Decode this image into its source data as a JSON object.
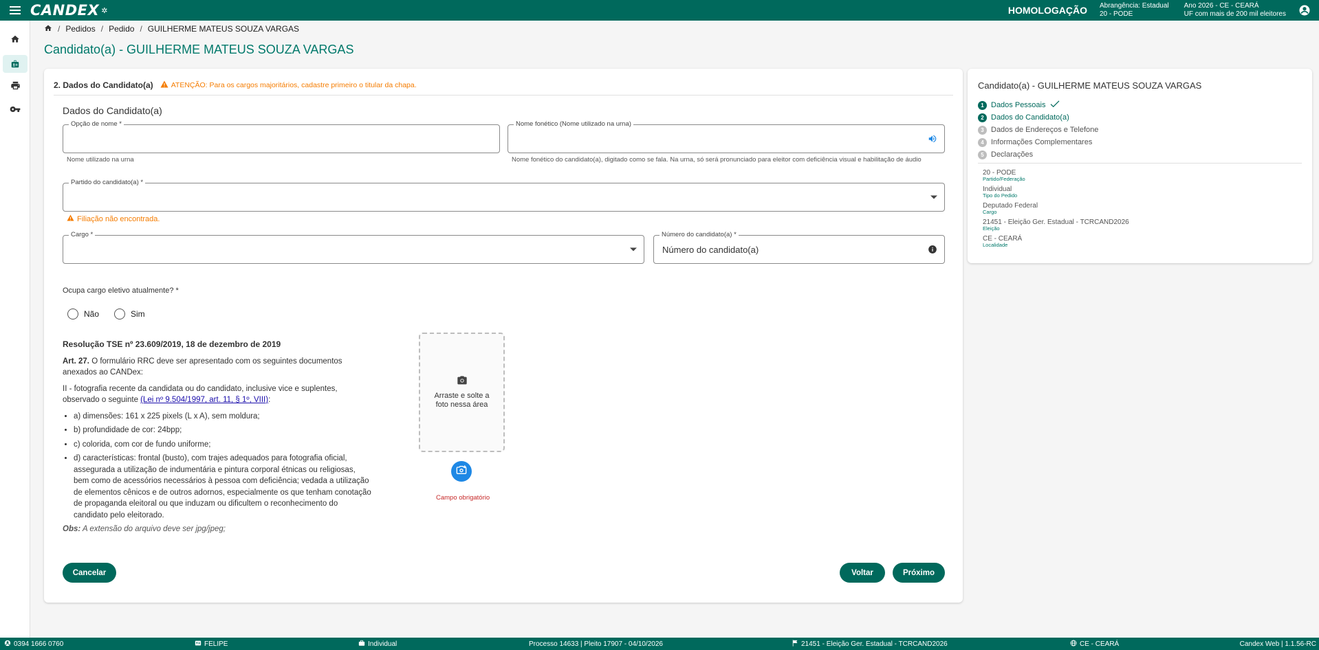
{
  "topbar": {
    "logo": "CANDEX",
    "environment": "HOMOLOGAÇÃO",
    "abrangencia_line1": "Abrangência: Estadual",
    "abrangencia_line2": "20 - PODE",
    "ano_line1": "Ano 2026 - CE - CEARÁ",
    "ano_line2": "UF com mais de 200 mil eleitores"
  },
  "sidebar": {
    "items": [
      {
        "name": "home",
        "icon": "home-icon"
      },
      {
        "name": "pedidos",
        "icon": "badge-icon"
      },
      {
        "name": "print",
        "icon": "print-icon"
      },
      {
        "name": "key",
        "icon": "key-icon"
      }
    ]
  },
  "breadcrumb": {
    "items": [
      "Pedidos",
      "Pedido",
      "GUILHERME MATEUS SOUZA VARGAS"
    ]
  },
  "page": {
    "title": "Candidato(a) - GUILHERME MATEUS SOUZA VARGAS"
  },
  "section": {
    "number_title": "2. Dados do Candidato(a)",
    "warning": "ATENÇÃO: Para os cargos majoritários, cadastre primeiro o titular da chapa.",
    "subtitle": "Dados do Candidato(a)"
  },
  "form": {
    "nome": {
      "label": "Opção de nome *",
      "value": "",
      "hint": "Nome utilizado na urna"
    },
    "fonetico": {
      "label": "Nome fonético (Nome utilizado na urna)",
      "value": "",
      "hint": "Nome fonético do candidato(a), digitado como se fala. Na urna, só será pronunciado para eleitor com deficiência visual e habilitação de áudio"
    },
    "partido": {
      "label": "Partido do candidato(a) *",
      "value": "",
      "error": "Filiação não encontrada."
    },
    "cargo": {
      "label": "Cargo *",
      "value": ""
    },
    "numero": {
      "label": "Número do candidato(a) *",
      "placeholder": "Número do candidato(a)"
    },
    "ocupa_cargo": {
      "question": "Ocupa cargo eletivo atualmente? *",
      "options": [
        "Não",
        "Sim"
      ]
    }
  },
  "resolution": {
    "title": "Resolução TSE nº 23.609/2019, 18 de dezembro de 2019",
    "art_label": "Art. 27.",
    "art_text": " O formulário RRC deve ser apresentado com os seguintes documentos anexados ao CANDex:",
    "item2": "II - fotografia recente da candidata ou do candidato, inclusive vice e suplentes, observado o seguinte ",
    "law_link": "(Lei nº 9.504/1997, art. 11, § 1º, VIII)",
    "law_suffix": ":",
    "bullets": [
      "a) dimensões: 161 x 225 pixels (L x A), sem moldura;",
      "b) profundidade de cor: 24bpp;",
      "c) colorida, com cor de fundo uniforme;",
      "d) características: frontal (busto), com trajes adequados para fotografia oficial, assegurada a utilização de indumentária e pintura corporal étnicas ou religiosas, bem como de acessórios necessários à pessoa com deficiência; vedada a utilização de elementos cênicos e de outros adornos, especialmente os que tenham conotação de propaganda eleitoral ou que induzam ou dificultem o reconhecimento do candidato pelo eleitorado."
    ],
    "obs_label": "Obs:",
    "obs_text": " A extensão do arquivo deve ser jpg/jpeg;"
  },
  "photo": {
    "drop_text": "Arraste e solte a foto nessa área",
    "required": "Campo obrigatório"
  },
  "buttons": {
    "cancel": "Cancelar",
    "back": "Voltar",
    "next": "Próximo"
  },
  "side_card": {
    "title": "Candidato(a) - GUILHERME MATEUS SOUZA VARGAS",
    "steps": [
      {
        "num": "1",
        "label": "Dados Pessoais",
        "state": "done"
      },
      {
        "num": "2",
        "label": "Dados do Candidato(a)",
        "state": "current"
      },
      {
        "num": "3",
        "label": "Dados de Endereços e Telefone",
        "state": "pending"
      },
      {
        "num": "4",
        "label": "Informações Complementares",
        "state": "pending"
      },
      {
        "num": "5",
        "label": "Declarações",
        "state": "pending"
      }
    ],
    "info": [
      {
        "value": "20 - PODE",
        "key": "Partido/Federação"
      },
      {
        "value": "Individual",
        "key": "Tipo do Pedido"
      },
      {
        "value": "Deputado Federal",
        "key": "Cargo"
      },
      {
        "value": "21451 - Eleição Ger. Estadual - TCRCAND2026",
        "key": "Eleição"
      },
      {
        "value": "CE - CEARÁ",
        "key": "Localidade"
      }
    ]
  },
  "statusbar": {
    "phone": "0394 1666 0760",
    "user": "FELIPE",
    "type": "Individual",
    "process": "Processo 14633 | Pleito 17907 - 04/10/2026",
    "election": "21451 - Eleição Ger. Estadual - TCRCAND2026",
    "locality": "CE - CEARÁ",
    "version": "Candex Web | 1.1.56-RC"
  },
  "colors": {
    "primary": "#00695c",
    "title": "#00796b",
    "warning": "#f57c00",
    "error": "#c62828",
    "photo_button": "#1e88e5"
  }
}
